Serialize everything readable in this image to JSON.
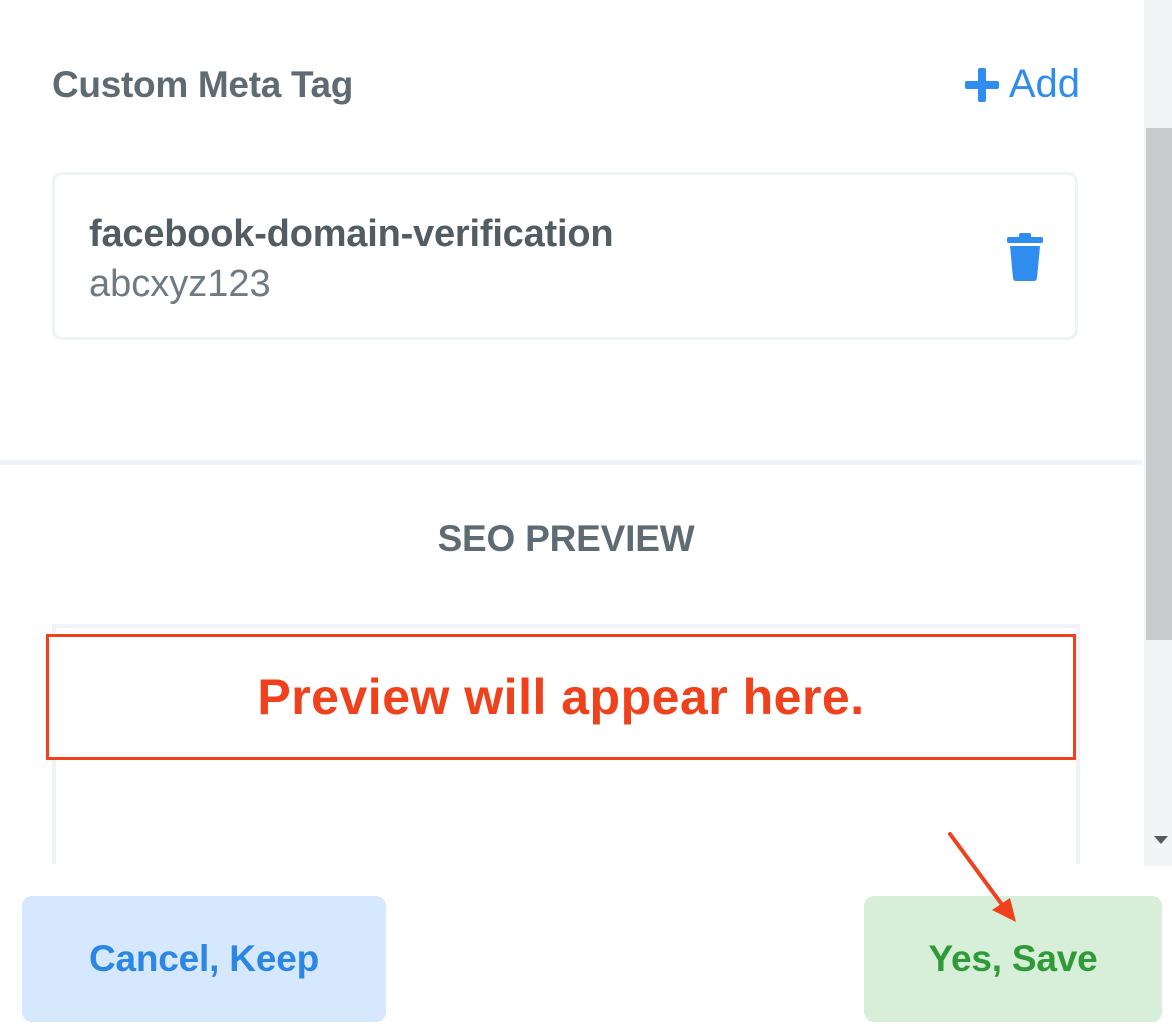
{
  "custom_meta": {
    "title": "Custom Meta Tag",
    "add_label": "Add",
    "tags": [
      {
        "name": "facebook-domain-verification",
        "value": "abcxyz123"
      }
    ]
  },
  "seo_preview": {
    "title": "SEO PREVIEW",
    "placeholder": "Preview will appear here."
  },
  "footer": {
    "cancel_label": "Cancel, Keep",
    "save_label": "Yes, Save"
  },
  "colors": {
    "accent_blue": "#2f8df0",
    "save_green": "#2f9b38",
    "annotation_red": "#f0411d"
  },
  "icons": {
    "add": "plus-icon",
    "delete": "trash-icon"
  }
}
